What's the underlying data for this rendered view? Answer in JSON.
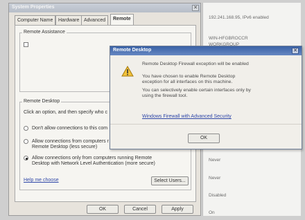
{
  "sysprops": {
    "title": "System Properties",
    "tabs": [
      "Computer Name",
      "Hardware",
      "Advanced",
      "Remote"
    ],
    "remote_assistance": {
      "group_label": "Remote Assistance"
    },
    "remote_desktop": {
      "group_label": "Remote Desktop",
      "instruction": "Click an option, and then specify who c",
      "options": [
        "Don't allow connections to this com",
        "Allow connections from computers r\nRemote Desktop (less secure)",
        "Allow connections only from computers running Remote\nDesktop with Network Level Authentication (more secure)"
      ],
      "help_link": "Help me choose",
      "select_users": "Select Users..."
    },
    "buttons": {
      "ok": "OK",
      "cancel": "Cancel",
      "apply": "Apply"
    }
  },
  "rightpane": {
    "lines_top": [
      "192.241.168.95, IPv6 enabled",
      "",
      "WIN-HFGBROCCR",
      "WORKGROUP"
    ],
    "lines_bottom": [
      "Never",
      "Never",
      "Disabled",
      "On"
    ]
  },
  "dialog": {
    "title": "Remote Desktop",
    "heading": "Remote Desktop Firewall exception will be enabled",
    "para1": "You have chosen to enable Remote Desktop exception for all interfaces on this machine.",
    "para2": "You can selectively enable certain interfaces only by using the firewall tool.",
    "link": "Windows Firewall with Advanced Security",
    "ok": "OK",
    "icon": "warning-icon"
  }
}
